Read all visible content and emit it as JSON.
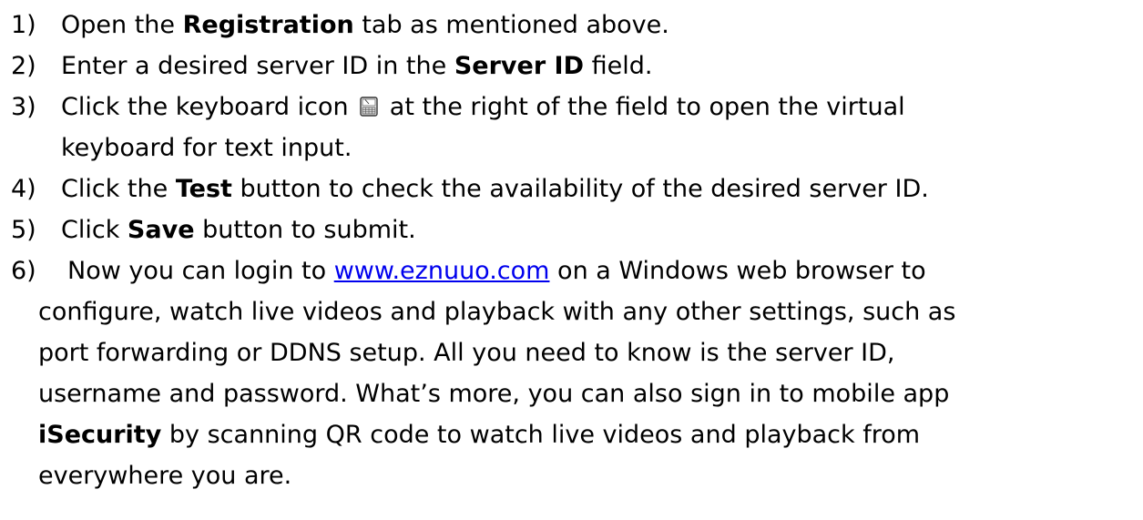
{
  "steps": [
    {
      "number": "1)",
      "parts": [
        "Open the ",
        "Registration",
        " tab as mentioned above."
      ]
    },
    {
      "number": "2)",
      "parts": [
        "Enter a desired server ID in the ",
        "Server ID",
        " field."
      ]
    },
    {
      "number": "3)",
      "text_before_icon": "Click the keyboard icon",
      "icon": "keyboard-icon",
      "text_after_icon": "at the right of the field to open the virtual",
      "continuation": "keyboard for text input."
    },
    {
      "number": "4)",
      "parts": [
        "Click the ",
        "Test",
        " button to check the availability of the desired server ID."
      ]
    },
    {
      "number": "5)",
      "parts": [
        "Click ",
        "Save",
        " button to submit."
      ]
    },
    {
      "number": "6)",
      "first_line_before_link": "Now you can login to ",
      "link_text": "www.eznuuo.com",
      "first_line_after_link": " on a Windows web browser to",
      "lines": [
        "configure, watch live videos and playback with any other settings, such as",
        "port forwarding or DDNS setup. All you need to know is the server ID,",
        "username and password. What’s more, you can also sign in to mobile app"
      ],
      "app_name": "iSecurity",
      "app_line_rest": " by scanning QR code to watch live videos and playback from",
      "last_line": "everywhere you are."
    }
  ]
}
